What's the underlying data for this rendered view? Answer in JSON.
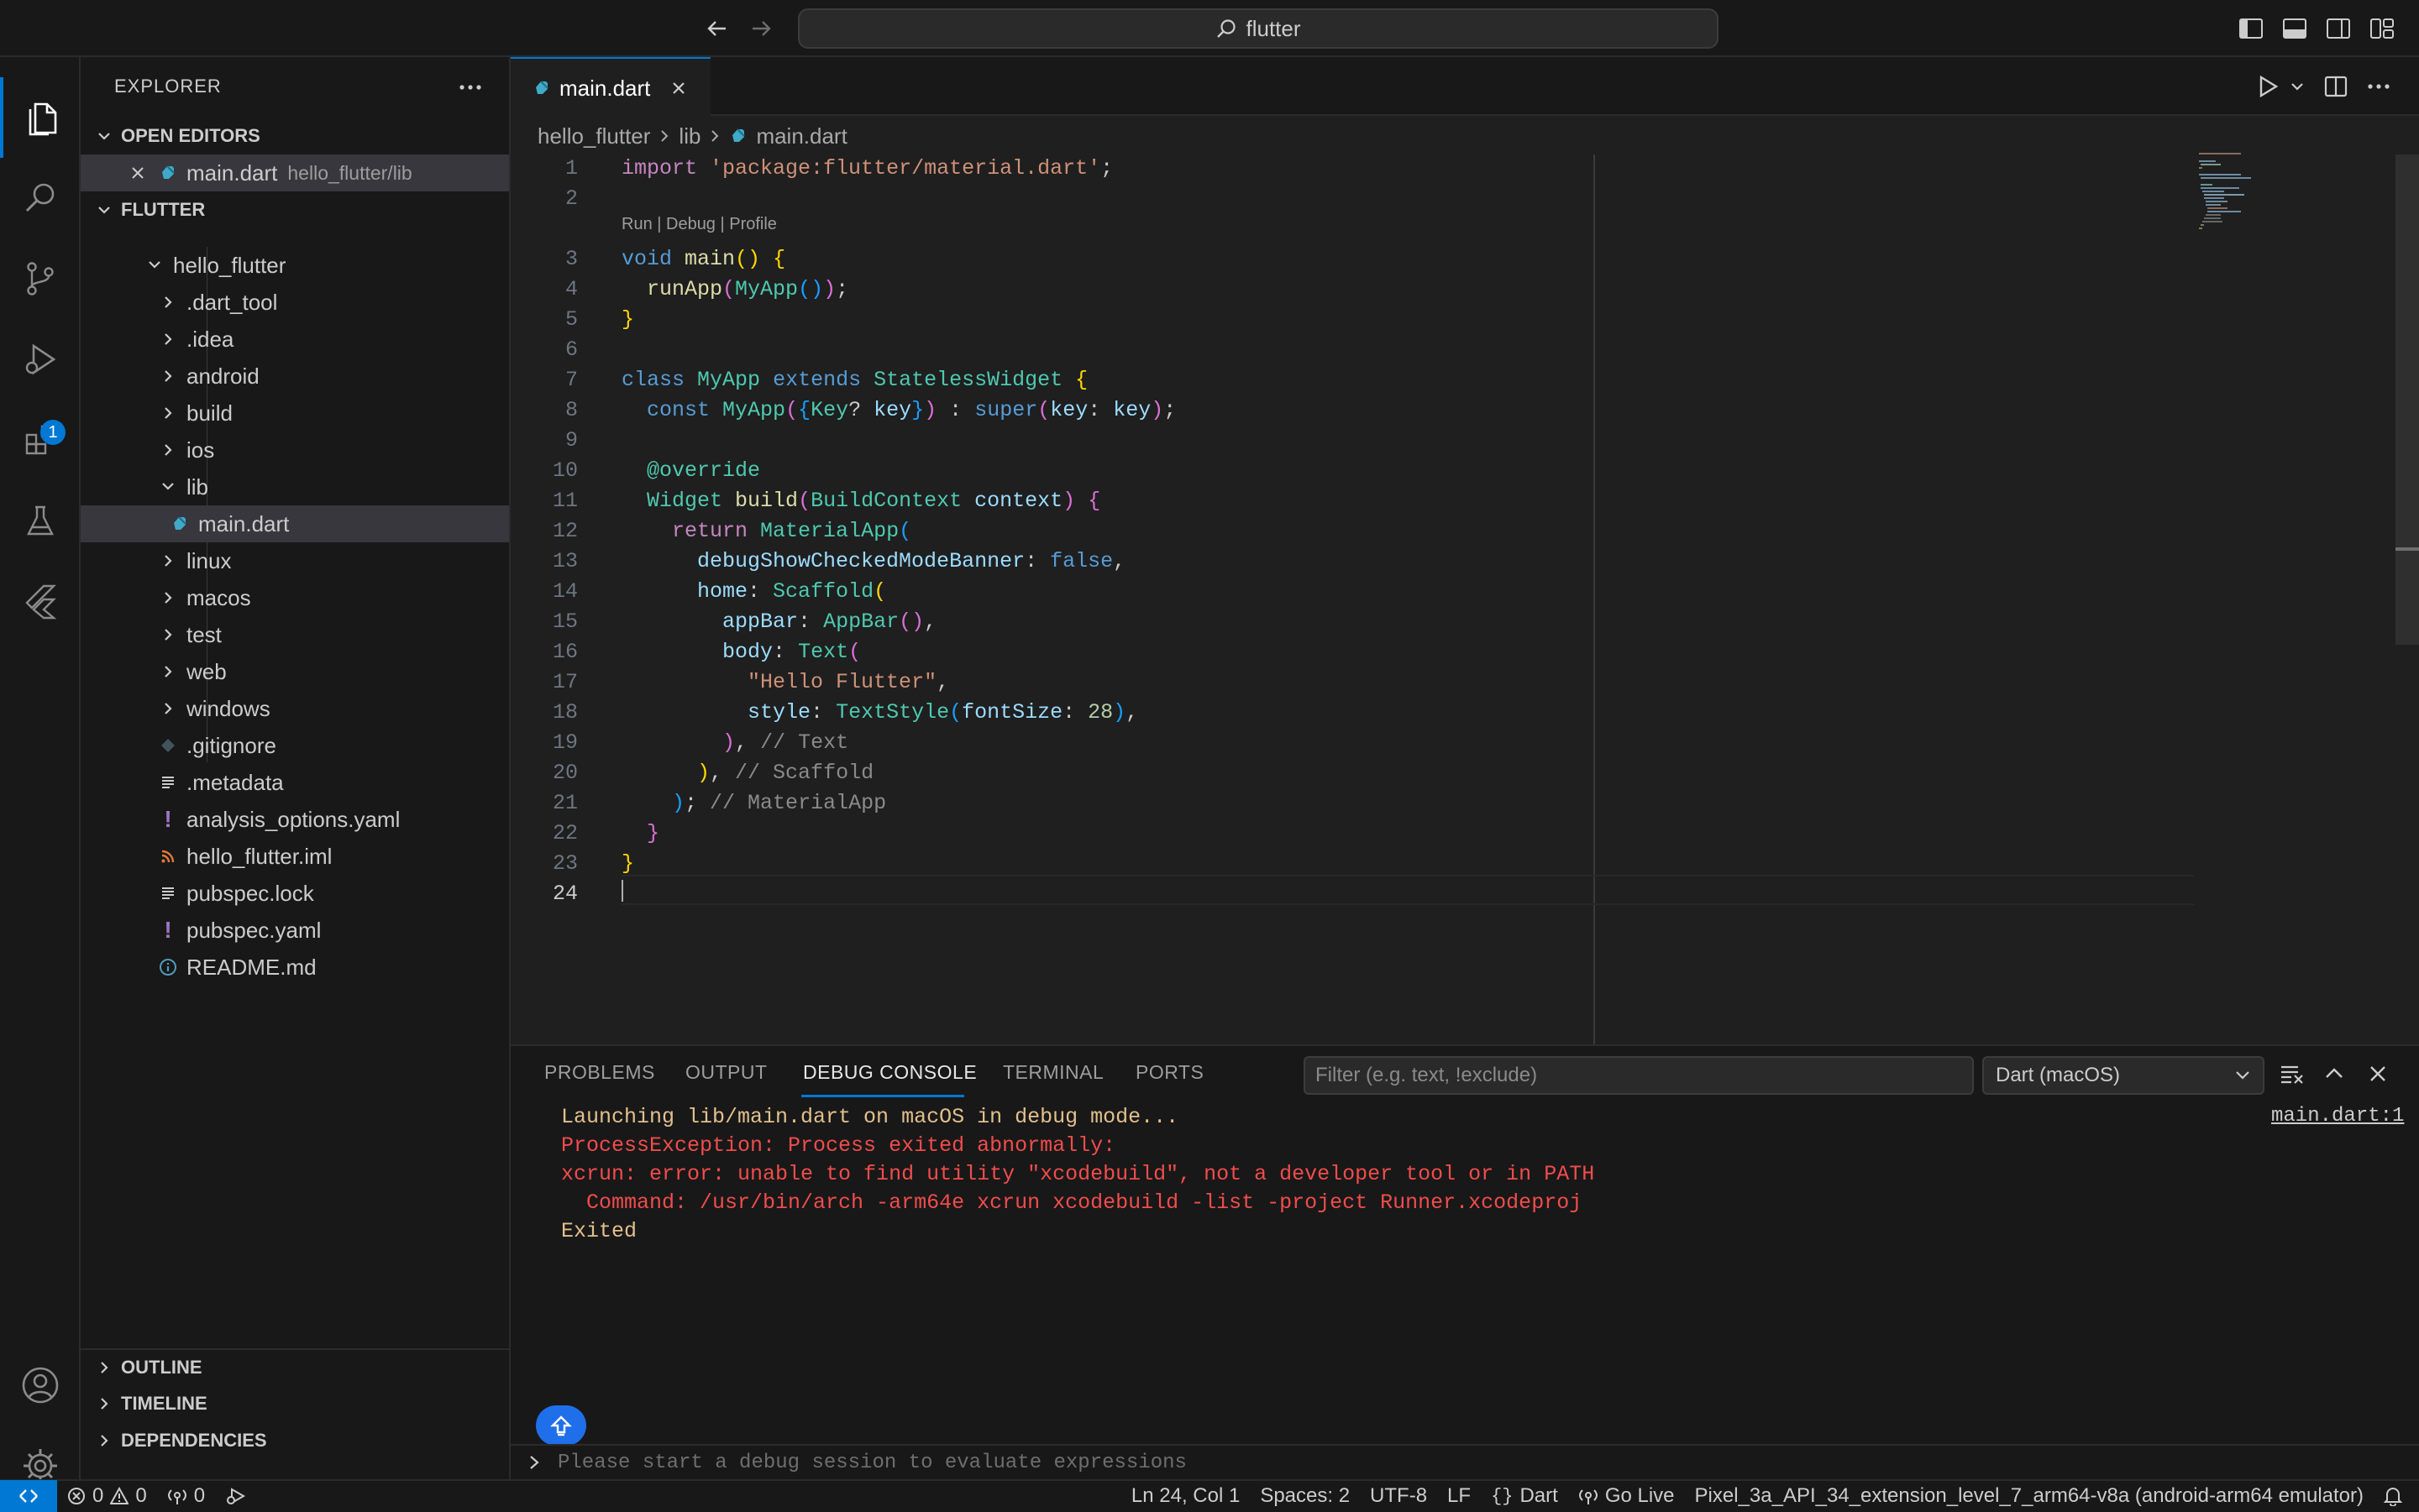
{
  "titlebar": {
    "search_text": "flutter"
  },
  "activity": {
    "extensions_badge": "1"
  },
  "sidebar": {
    "title": "EXPLORER",
    "open_editors_header": "OPEN EDITORS",
    "open_editor": {
      "name": "main.dart",
      "path": "hello_flutter/lib"
    },
    "folder_header": "FLUTTER",
    "tree": [
      {
        "label": "hello_flutter",
        "kind": "folder-open"
      },
      {
        "label": ".dart_tool",
        "kind": "folder"
      },
      {
        "label": ".idea",
        "kind": "folder"
      },
      {
        "label": "android",
        "kind": "folder"
      },
      {
        "label": "build",
        "kind": "folder"
      },
      {
        "label": "ios",
        "kind": "folder"
      },
      {
        "label": "lib",
        "kind": "folder-open"
      },
      {
        "label": "main.dart",
        "kind": "dart-file"
      },
      {
        "label": "linux",
        "kind": "folder"
      },
      {
        "label": "macos",
        "kind": "folder"
      },
      {
        "label": "test",
        "kind": "folder"
      },
      {
        "label": "web",
        "kind": "folder"
      },
      {
        "label": "windows",
        "kind": "folder"
      },
      {
        "label": ".gitignore",
        "kind": "git-file"
      },
      {
        "label": ".metadata",
        "kind": "text-file"
      },
      {
        "label": "analysis_options.yaml",
        "kind": "yaml-file"
      },
      {
        "label": "hello_flutter.iml",
        "kind": "rss-file"
      },
      {
        "label": "pubspec.lock",
        "kind": "text-file"
      },
      {
        "label": "pubspec.yaml",
        "kind": "yaml-file"
      },
      {
        "label": "README.md",
        "kind": "info-file"
      }
    ],
    "outline": "OUTLINE",
    "timeline": "TIMELINE",
    "dependencies": "DEPENDENCIES"
  },
  "editor": {
    "tab_label": "main.dart",
    "breadcrumbs": [
      "hello_flutter",
      "lib",
      "main.dart"
    ],
    "codelens": "Run | Debug | Profile",
    "line_numbers": [
      "1",
      "2",
      "3",
      "4",
      "5",
      "6",
      "7",
      "8",
      "9",
      "10",
      "11",
      "12",
      "13",
      "14",
      "15",
      "16",
      "17",
      "18",
      "19",
      "20",
      "21",
      "22",
      "23",
      "24"
    ],
    "code": [
      "import 'package:flutter/material.dart';",
      "",
      "void main() {",
      "  runApp(MyApp());",
      "}",
      "",
      "class MyApp extends StatelessWidget {",
      "  const MyApp({Key? key}) : super(key: key);",
      "",
      "  @override",
      "  Widget build(BuildContext context) {",
      "    return MaterialApp(",
      "      debugShowCheckedModeBanner: false,",
      "      home: Scaffold(",
      "        appBar: AppBar(),",
      "        body: Text(",
      "          \"Hello Flutter\",",
      "          style: TextStyle(fontSize: 28),",
      "        ), // Text",
      "      ), // Scaffold",
      "    ); // MaterialApp",
      "  }",
      "}",
      ""
    ]
  },
  "panel": {
    "tabs": [
      "PROBLEMS",
      "OUTPUT",
      "DEBUG CONSOLE",
      "TERMINAL",
      "PORTS"
    ],
    "active_tab": "DEBUG CONSOLE",
    "filter_placeholder": "Filter (e.g. text, !exclude)",
    "dart_select": "Dart (macOS)",
    "source_link": "main.dart:1",
    "output": [
      {
        "text": "Launching lib/main.dart on macOS in debug mode...",
        "color": "#e2c08d"
      },
      {
        "text": "ProcessException: Process exited abnormally:",
        "color": "#f14c4c"
      },
      {
        "text": "xcrun: error: unable to find utility \"xcodebuild\", not a developer tool or in PATH",
        "color": "#f14c4c"
      },
      {
        "text": "  Command: /usr/bin/arch -arm64e xcrun xcodebuild -list -project Runner.xcodeproj",
        "color": "#f14c4c"
      },
      {
        "text": "Exited",
        "color": "#e2c08d"
      }
    ],
    "eval_placeholder": "Please start a debug session to evaluate expressions"
  },
  "status": {
    "errors": "0",
    "warnings": "0",
    "ports": "0",
    "position": "Ln 24, Col 1",
    "spaces": "Spaces: 2",
    "encoding": "UTF-8",
    "eol": "LF",
    "language": "Dart",
    "golive": "Go Live",
    "device": "Pixel_3a_API_34_extension_level_7_arm64-v8a (android-arm64 emulator)"
  },
  "colors": {
    "accent": "#0078d4",
    "error": "#f14c4c",
    "warning": "#e2c08d"
  }
}
